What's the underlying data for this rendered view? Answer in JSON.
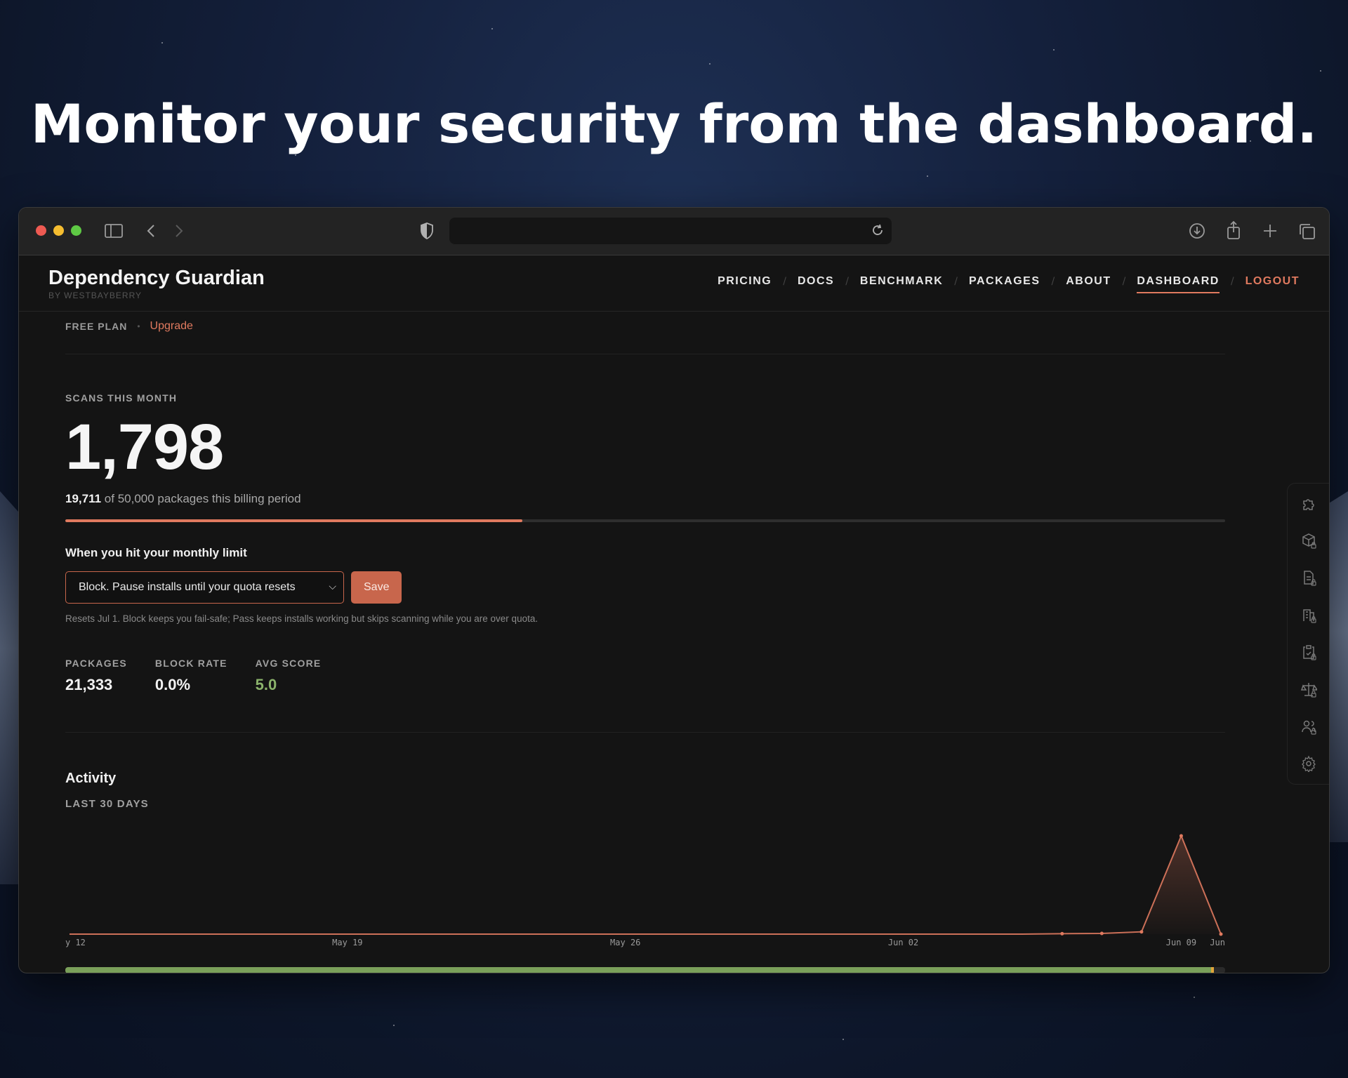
{
  "headline": "Monitor your security from the dashboard.",
  "browser": {
    "icons": [
      "sidebar-icon",
      "back-icon",
      "forward-icon",
      "shield-icon",
      "reload-icon",
      "download-icon",
      "share-icon",
      "new-tab-icon",
      "tabs-overview-icon"
    ]
  },
  "brand": {
    "title": "Dependency Guardian",
    "subtitle": "BY WESTBAYBERRY"
  },
  "nav": {
    "pricing": "PRICING",
    "docs": "DOCS",
    "benchmark": "BENCHMARK",
    "packages": "PACKAGES",
    "about": "ABOUT",
    "dashboard": "DASHBOARD",
    "logout": "LOGOUT",
    "separator": "/"
  },
  "plan": {
    "label": "FREE PLAN",
    "separator": "•",
    "upgrade": "Upgrade"
  },
  "scans": {
    "label": "SCANS THIS MONTH",
    "value": "1,798",
    "used": "19,711",
    "period_text": "of 50,000 packages this billing period",
    "progress_fraction": 0.3942
  },
  "limit": {
    "title": "When you hit your monthly limit",
    "selected_option": "Block. Pause installs until your quota resets",
    "save_label": "Save",
    "hint": "Resets Jul 1. Block keeps you fail-safe; Pass keeps installs working but skips scanning while you are over quota."
  },
  "stats": {
    "packages_label": "PACKAGES",
    "packages_value": "21,333",
    "block_rate_label": "BLOCK RATE",
    "block_rate_value": "0.0%",
    "avg_score_label": "AVG SCORE",
    "avg_score_value": "5.0"
  },
  "activity": {
    "title": "Activity",
    "subtitle": "LAST 30 DAYS"
  },
  "chart_data": {
    "type": "area",
    "x_tick_labels": [
      "y 12",
      "May 19",
      "May 26",
      "Jun 02",
      "Jun 09",
      "Jun"
    ],
    "x": [
      "May 12",
      "May 13",
      "May 14",
      "May 15",
      "May 16",
      "May 17",
      "May 18",
      "May 19",
      "May 20",
      "May 21",
      "May 22",
      "May 23",
      "May 24",
      "May 25",
      "May 26",
      "May 27",
      "May 28",
      "May 29",
      "May 30",
      "May 31",
      "Jun 01",
      "Jun 02",
      "Jun 03",
      "Jun 04",
      "Jun 05",
      "Jun 06",
      "Jun 07",
      "Jun 08",
      "Jun 09",
      "Jun 10"
    ],
    "values": [
      0,
      0,
      0,
      0,
      0,
      0,
      0,
      0,
      0,
      0,
      0,
      0,
      0,
      0,
      0,
      0,
      0,
      0,
      0,
      0,
      0,
      0,
      0,
      0,
      0,
      8,
      12,
      40,
      1700,
      0
    ],
    "color": "#e07a5f",
    "grid": false,
    "legend": "none"
  },
  "quota_bar": {
    "green_fraction": 0.988,
    "green_color": "#7aa05a",
    "marker_color": "#e0a53a"
  },
  "rail": {
    "icons": [
      "puzzle-icon",
      "package-lock-icon",
      "document-lock-icon",
      "building-lock-icon",
      "clipboard-lock-icon",
      "scale-lock-icon",
      "users-lock-icon",
      "settings-icon"
    ]
  },
  "colors": {
    "accent": "#e07a5f",
    "green": "#8bb36b",
    "background": "#141414"
  }
}
